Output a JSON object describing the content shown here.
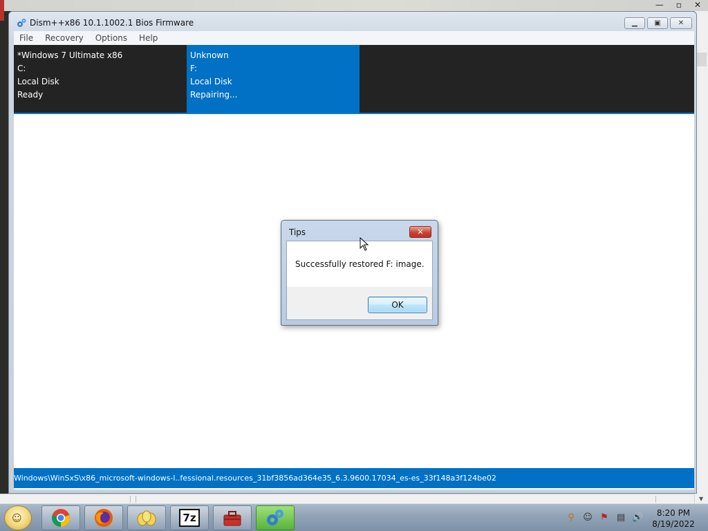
{
  "window": {
    "title": "Dism++x86 10.1.1002.1 Bios Firmware",
    "minimize_icon": "minimize-icon",
    "maximize_icon": "maximize-icon",
    "close_icon": "close-icon"
  },
  "menu": {
    "items": [
      "File",
      "Recovery",
      "Options",
      "Help"
    ]
  },
  "images": [
    {
      "name": "*Windows 7 Ultimate x86",
      "drive": "C:",
      "type": "Local Disk",
      "status": "Ready",
      "selected": false
    },
    {
      "name": "Unknown",
      "drive": "F:",
      "type": "Local Disk",
      "status": "Repairing...",
      "selected": true
    }
  ],
  "status_bar": {
    "text": "Windows\\WinSxS\\x86_microsoft-windows-l..fessional.resources_31bf3856ad364e35_6.3.9600.17034_es-es_33f148a3f124be02"
  },
  "dialog": {
    "title": "Tips",
    "message": "Successfully restored F: image.",
    "ok_label": "OK",
    "close_glyph": "✕"
  },
  "taskbar": {
    "apps": [
      "chrome-icon",
      "firefox-icon",
      "group-icon",
      "7zip-icon",
      "toolbox-icon",
      "dism-gear-icon"
    ],
    "sevenzip_label": "7z",
    "clock_time": "8:20 PM",
    "clock_date": "8/19/2022"
  },
  "colors": {
    "accent": "#0071c5",
    "image_strip_bg": "#232323"
  }
}
